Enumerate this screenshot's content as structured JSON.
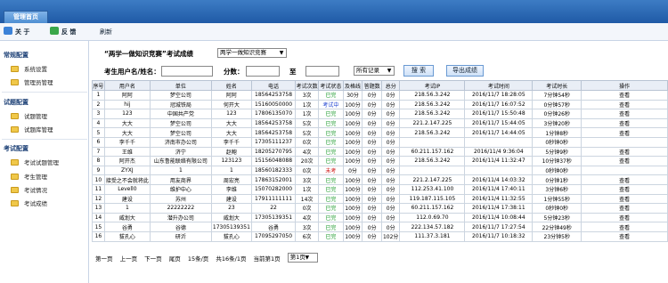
{
  "header": {
    "tab": "管理首页"
  },
  "toolbar": {
    "about": "关 于",
    "feedback": "反 馈",
    "refresh": "刷新"
  },
  "sidebar": {
    "groups": [
      {
        "title": "常规配置",
        "items": [
          "系统设置",
          "管理员管理"
        ]
      },
      {
        "title": "试题配置",
        "items": [
          "试题管理",
          "试题库管理"
        ]
      },
      {
        "title": "考试配置",
        "items": [
          "考试试题管理",
          "考生管理",
          "考试情况",
          "考试成绩"
        ]
      }
    ]
  },
  "filters": {
    "title": "“两学一做知识竞赛”考试成绩",
    "exam_select": "两学一做知识竞赛",
    "user_label": "考生用户名/姓名：",
    "score_label": "分数：",
    "to_label": "至",
    "record_select": "所有记录",
    "search": "搜 索",
    "export": "导出成绩"
  },
  "table": {
    "headers": [
      "序号",
      "用户名",
      "单位",
      "姓名",
      "电话",
      "考试次数",
      "考试状态",
      "及格线",
      "答题数",
      "总分",
      "考试IP",
      "考试时间",
      "考试时长",
      "操作"
    ],
    "rows": [
      [
        "1",
        "阿阿",
        "梦空公司",
        "阿阿",
        "18564253758",
        "3次",
        "已完",
        "30分",
        "0分",
        "0分",
        "218.56.3.242",
        "2016/11/7 18:28:05",
        "7分钟54秒",
        "查看"
      ],
      [
        "2",
        "hij",
        "冠城铁局",
        "何开大",
        "15160050000",
        "1次",
        "考试中",
        "100分",
        "0分",
        "0分",
        "218.56.3.242",
        "2016/11/7 16:07:52",
        "0分钟57秒",
        "查看"
      ],
      [
        "3",
        "123",
        "中国共产党",
        "123",
        "17806135070",
        "1次",
        "已完",
        "100分",
        "0分",
        "0分",
        "218.56.3.242",
        "2016/11/7 15:50:48",
        "0分钟26秒",
        "查看"
      ],
      [
        "4",
        "大大",
        "梦空公司",
        "大大",
        "18564253758",
        "5次",
        "已完",
        "100分",
        "0分",
        "0分",
        "221.2.147.225",
        "2016/11/7 15:44:05",
        "3分钟20秒",
        "查看"
      ],
      [
        "5",
        "大大",
        "梦空公司",
        "大大",
        "18564253758",
        "5次",
        "已完",
        "100分",
        "0分",
        "0分",
        "218.56.3.242",
        "2016/11/7 14:44:05",
        "1分钟8秒",
        "查看"
      ],
      [
        "6",
        "李千千",
        "济南市办公司",
        "李千千",
        "17305111237",
        "0次",
        "已完",
        "100分",
        "0分",
        "0分",
        "",
        "",
        "0秒钟0秒",
        ""
      ],
      [
        "7",
        "王维",
        "济宁",
        "赵鲍",
        "18205270795",
        "4次",
        "已完",
        "100分",
        "0分",
        "0分",
        "60.211.157.162",
        "2016/11/4 9:36:04",
        "5分钟9秒",
        "查看"
      ],
      [
        "8",
        "阿开杰",
        "山东鲁能联络有限公司",
        "123123",
        "15156048088",
        "20次",
        "已完",
        "100分",
        "0分",
        "0分",
        "218.56.3.242",
        "2016/11/4 11:32:47",
        "10分钟37秒",
        "查看"
      ],
      [
        "9",
        "ZYXJ",
        "1",
        "1",
        "18560182333",
        "0次",
        "未考",
        "0分",
        "0分",
        "0分",
        "",
        "",
        "0秒钟0秒",
        ""
      ],
      [
        "10",
        "接受之不会就将此",
        "用友商界",
        "周宏亮",
        "17863152001",
        "3次",
        "已完",
        "100分",
        "0分",
        "0分",
        "221.2.147.225",
        "2016/11/4 14:03:32",
        "0分钟1秒",
        "查看"
      ],
      [
        "11",
        "Levell0",
        "维护中心",
        "李维",
        "15070282000",
        "1次",
        "已完",
        "100分",
        "0分",
        "0分",
        "112.253.41.100",
        "2016/11/4 17:40:11",
        "3分钟6秒",
        "查看"
      ],
      [
        "12",
        "建设",
        "苏州",
        "建设",
        "17911111111",
        "14次",
        "已完",
        "100分",
        "0分",
        "0分",
        "119.187.115.105",
        "2016/11/4 11:32:55",
        "1分钟55秒",
        "查看"
      ],
      [
        "13",
        "1",
        "22222222",
        "23",
        "22",
        "0次",
        "已完",
        "100分",
        "0分",
        "0分",
        "60.211.157.162",
        "2016/11/4 17:38:11",
        "0秒钟0秒",
        "查看"
      ],
      [
        "14",
        "威划大",
        "潜升办公司",
        "威划大",
        "17305139351",
        "4次",
        "已完",
        "100分",
        "0分",
        "0分",
        "112.0.69.70",
        "2016/11/4 10:08:44",
        "5分钟23秒",
        "查看"
      ],
      [
        "15",
        "谷勇",
        "谷德",
        "17305139351",
        "谷勇",
        "3次",
        "已完",
        "100分",
        "0分",
        "0分",
        "222.134.57.182",
        "2016/11/7 17:27:54",
        "22分钟49秒",
        "查看"
      ],
      [
        "16",
        "拔孔心",
        "研沂",
        "拔孔心",
        "17095297050",
        "6次",
        "已完",
        "100分",
        "0分",
        "102分",
        "111.37.3.181",
        "2016/11/7 10:18:32",
        "23分钟5秒",
        "查看"
      ]
    ]
  },
  "pager": {
    "first": "第一页",
    "prev": "上一页",
    "next": "下一页",
    "last": "尾页",
    "per_page": "15条/页",
    "total": "共16条/1页",
    "current": "当前第1页",
    "goto": "第1页"
  }
}
